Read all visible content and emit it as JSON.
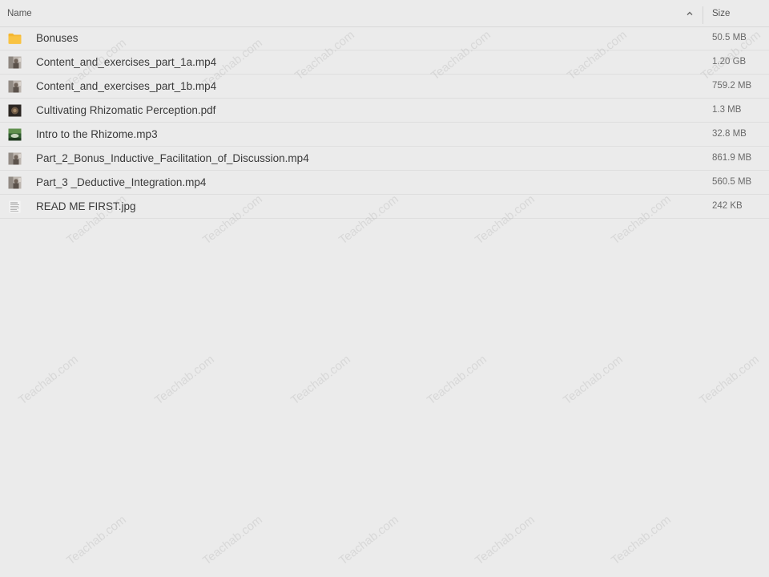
{
  "header": {
    "name_label": "Name",
    "size_label": "Size",
    "sort_icon": "chevron-up-icon"
  },
  "files": [
    {
      "name": "Bonuses",
      "size": "50.5 MB",
      "icon": "folder-icon"
    },
    {
      "name": "Content_and_exercises_part_1a.mp4",
      "size": "1.20 GB",
      "icon": "video-thumbnail-icon"
    },
    {
      "name": "Content_and_exercises_part_1b.mp4",
      "size": "759.2 MB",
      "icon": "video-thumbnail-icon"
    },
    {
      "name": "Cultivating Rhizomatic Perception.pdf",
      "size": "1.3 MB",
      "icon": "pdf-thumbnail-icon"
    },
    {
      "name": "Intro to the Rhizome.mp3",
      "size": "32.8 MB",
      "icon": "audio-thumbnail-icon"
    },
    {
      "name": "Part_2_Bonus_Inductive_Facilitation_of_Discussion.mp4",
      "size": "861.9 MB",
      "icon": "video-thumbnail-icon"
    },
    {
      "name": "Part_3 _Deductive_Integration.mp4",
      "size": "560.5 MB",
      "icon": "video-thumbnail-icon"
    },
    {
      "name": "READ ME FIRST.jpg",
      "size": "242 KB",
      "icon": "image-thumbnail-icon"
    }
  ],
  "watermark": "Teachab.com",
  "colors": {
    "background": "#ebebeb",
    "folder": "#f5b731",
    "row_border": "#dedede"
  }
}
